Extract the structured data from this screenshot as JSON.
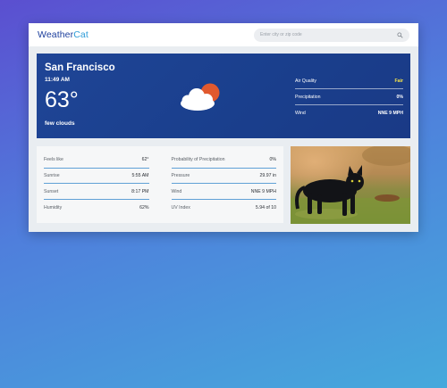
{
  "header": {
    "logo_part1": "Weather",
    "logo_part2": "Cat",
    "search_placeholder": "Enter city or zip code"
  },
  "current": {
    "city": "San Francisco",
    "time": "11:49 AM",
    "temperature": "63°",
    "condition": "few clouds",
    "icon": "partly-cloudy-icon"
  },
  "hero_stats": [
    {
      "label": "Air Quality",
      "value": "Fair"
    },
    {
      "label": "Precipitation",
      "value": "0%"
    },
    {
      "label": "Wind",
      "value": "NNE 9 MPH"
    }
  ],
  "details": {
    "left": [
      {
        "label": "Feels like",
        "value": "62°"
      },
      {
        "label": "Sunrise",
        "value": "5:55 AM"
      },
      {
        "label": "Sunset",
        "value": "8:17 PM"
      },
      {
        "label": "Humidity",
        "value": "62%"
      }
    ],
    "right": [
      {
        "label": "Probability of Precipitation",
        "value": "0%"
      },
      {
        "label": "Pressure",
        "value": "29.97 in"
      },
      {
        "label": "Wind",
        "value": "NNE 9 MPH"
      },
      {
        "label": "UV Index",
        "value": "5.94 of 10"
      }
    ]
  },
  "colors": {
    "brand_dark": "#1c3e9c",
    "brand_light": "#2e9cd8",
    "air_quality_fair": "#f3e24a",
    "divider": "#5fa0d6"
  }
}
